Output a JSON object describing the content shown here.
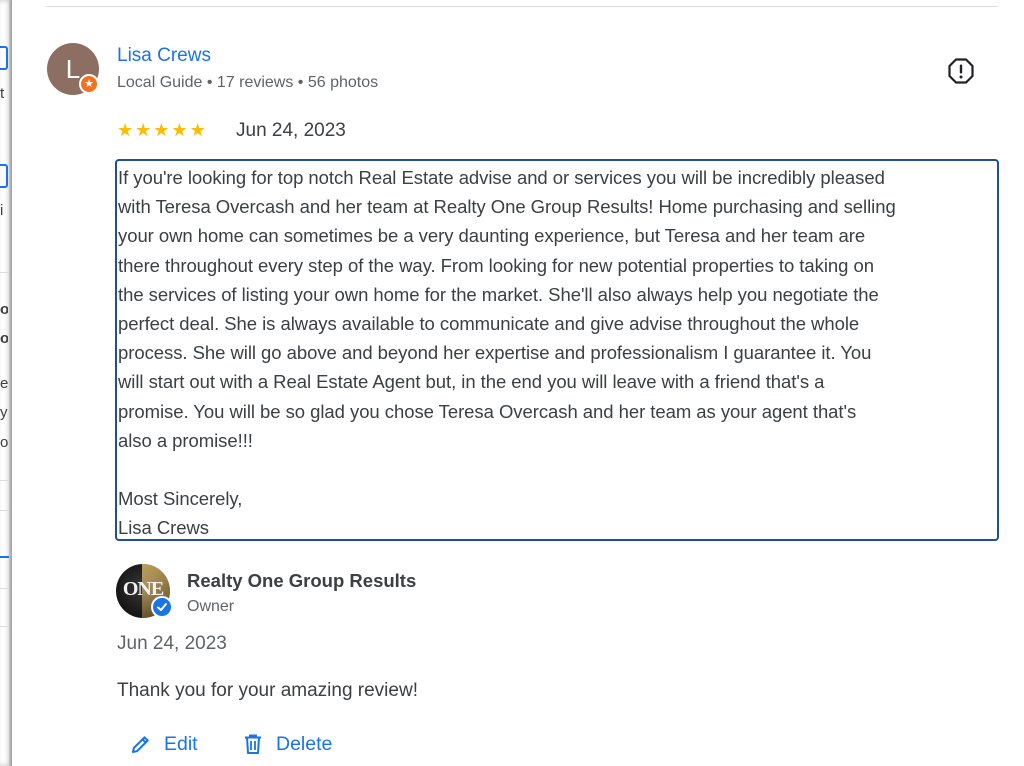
{
  "left_partial": {
    "fragments": [
      "t",
      "i",
      "o",
      "o",
      "e",
      "y",
      "o"
    ]
  },
  "review": {
    "reviewer_initial": "L",
    "reviewer_name": "Lisa Crews",
    "reviewer_meta": "Local Guide • 17 reviews • 56 photos",
    "rating": 5,
    "stars": [
      "★",
      "★",
      "★",
      "★",
      "★"
    ],
    "date": "Jun 24, 2023",
    "text": "If you're looking for top notch Real Estate advise and or services you will be incredibly pleased\nwith Teresa Overcash and her team at Realty One Group Results! Home purchasing and selling\nyour own home can sometimes be a very daunting experience, but Teresa and her team are\nthere throughout every step of the way. From looking for new potential properties to taking on\nthe services of listing your own home for the market. She'll also always help you negotiate the\nperfect deal. She is always available to communicate and give advise throughout the whole\nprocess. She will go above and beyond her expertise and professionalism I guarantee it. You\nwill start out with a Real Estate Agent but, in the end you will leave with a friend that's a\npromise. You will be so glad you chose Teresa Overcash and her team as your agent that's\nalso a promise!!!\n\nMost Sincerely,\nLisa Crews"
  },
  "owner_reply": {
    "logo_text": "ONE",
    "name": "Realty One Group Results",
    "role": "Owner",
    "date": "Jun 24, 2023",
    "text": "Thank you for your amazing review!"
  },
  "actions": {
    "edit_label": "Edit",
    "delete_label": "Delete"
  },
  "colors": {
    "accent": "#1a73e8",
    "star": "#fbbc04",
    "local_guide_badge": "#f5711f",
    "focus_border": "#1f4e9c"
  },
  "icons": {
    "flag": "report-icon",
    "edit": "pencil-icon",
    "delete": "trash-icon",
    "verified": "verified-check-icon",
    "local_guide": "local-guide-star-icon"
  }
}
